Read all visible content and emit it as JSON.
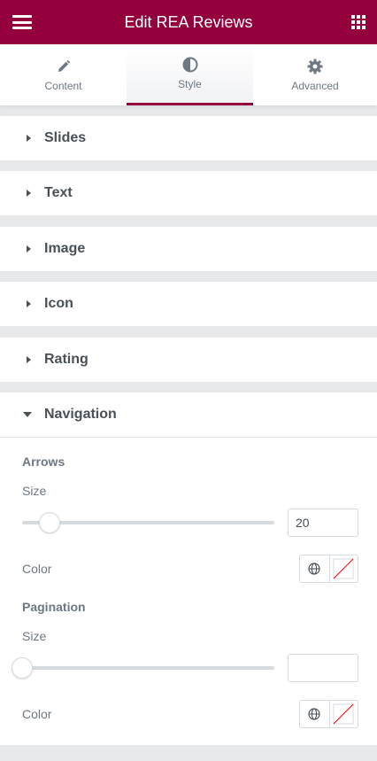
{
  "header": {
    "title": "Edit REA Reviews",
    "menu_icon": "hamburger-icon",
    "apps_icon": "grid-icon"
  },
  "tabs": [
    {
      "label": "Content",
      "icon": "pencil-icon"
    },
    {
      "label": "Style",
      "icon": "contrast-icon",
      "active": true
    },
    {
      "label": "Advanced",
      "icon": "gear-icon"
    }
  ],
  "sections": [
    {
      "label": "Slides"
    },
    {
      "label": "Text"
    },
    {
      "label": "Image"
    },
    {
      "label": "Icon"
    },
    {
      "label": "Rating"
    },
    {
      "label": "Navigation",
      "expanded": true
    }
  ],
  "navigation": {
    "arrows": {
      "heading": "Arrows",
      "size_label": "Size",
      "size_value": "20",
      "color_label": "Color"
    },
    "pagination": {
      "heading": "Pagination",
      "size_label": "Size",
      "size_value": "",
      "color_label": "Color"
    }
  },
  "colors": {
    "accent": "#93003c",
    "text": "#6d7882",
    "heading": "#495157",
    "background": "#e6e8ea",
    "unset_swatch_line": "#ff0000"
  }
}
